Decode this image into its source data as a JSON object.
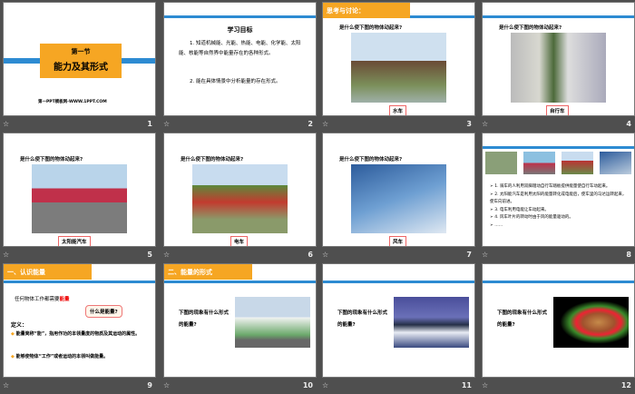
{
  "slides": [
    {
      "num": "1",
      "section": "第一节",
      "title": "能力及其形式",
      "footer": "第一PPT模板网-WWW.1PPT.COM"
    },
    {
      "num": "2",
      "title": "学习目标",
      "p1": "1. 知道机械能、光能、热能、电能、化学能、太阳能、核能等自然界中能量存在的各种形式。",
      "p2": "2. 能在具体情景中分析能量的存在形式。"
    },
    {
      "num": "3",
      "tag": "思考与讨论：",
      "question": "是什么使下图的物体动起来?",
      "caption": "水车"
    },
    {
      "num": "4",
      "question": "是什么使下图的物体动起来?",
      "caption": "自行车"
    },
    {
      "num": "5",
      "question": "是什么使下图的物体动起来?",
      "caption": "太阳能汽车"
    },
    {
      "num": "6",
      "question": "是什么使下图的物体动起来?",
      "caption": "电车"
    },
    {
      "num": "7",
      "question": "是什么使下图的物体动起来?",
      "caption": "风车"
    },
    {
      "num": "8",
      "items": [
        "1. 骑车的人利用双脚蹬动自行车踏板提供能量使自行车动起来。",
        "2. 太阳能汽车是利用太阳的能量转化成电能后，使车里的马达运转起来，使车向前进。",
        "3. 电车利用电能让车动起来。",
        "4. 风车叶片的转动时由于风的能量驱动的。",
        "……"
      ]
    },
    {
      "num": "9",
      "tag": "一、认识能量",
      "line": "任何物体工作都需要",
      "line_red": "能量",
      "bubble": "什么是能量?",
      "def": "定义：",
      "b1": "能量简称“能”，指用作功的本领量度的物质及其运动的属性。",
      "b2": "能够使物体“工作”或者运动的本领叫做能量。"
    },
    {
      "num": "10",
      "tag": "二、能量的形式",
      "question": "下图的现象有什么形式的能量?"
    },
    {
      "num": "11",
      "question": "下图的现象有什么形式的能量?"
    },
    {
      "num": "12",
      "question": "下图的现象有什么形式的能量?"
    }
  ],
  "footer_icon": "☆"
}
